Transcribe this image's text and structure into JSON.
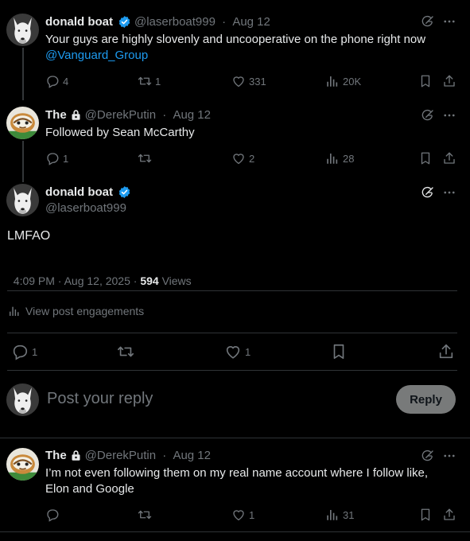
{
  "tweets": [
    {
      "name": "donald boat",
      "handle": "@laserboat999",
      "date": "Aug 12",
      "text": "Your guys are highly slovenly and uncooperative on the phone right now",
      "mention": "@Vanguard_Group",
      "replies": "4",
      "retweets": "1",
      "likes": "331",
      "views": "20K"
    },
    {
      "name": "The",
      "handle": "@DerekPutin",
      "date": "Aug 12",
      "text": "Followed by Sean McCarthy",
      "replies": "1",
      "retweets": "",
      "likes": "2",
      "views": "28"
    }
  ],
  "main": {
    "name": "donald boat",
    "handle": "@laserboat999",
    "text": "LMFAO",
    "timestamp": "4:09 PM · Aug 12, 2025 · ",
    "views_count": "594",
    "views_label": " Views",
    "engagements": "View post engagements",
    "replies": "1",
    "retweets": "",
    "likes": "1"
  },
  "compose": {
    "placeholder": "Post your reply",
    "button": "Reply"
  },
  "reply": {
    "name": "The",
    "handle": "@DerekPutin",
    "date": "Aug 12",
    "text": "I’m not even following them on my real name account where I follow like, Elon and Google",
    "replies": "",
    "retweets": "",
    "likes": "1",
    "views": "31"
  },
  "separator": " · ",
  "colors": {
    "accent": "#1d9bf0",
    "muted": "#71767b",
    "divider": "#2f3336",
    "reply_button_bg": "#787a7a"
  }
}
